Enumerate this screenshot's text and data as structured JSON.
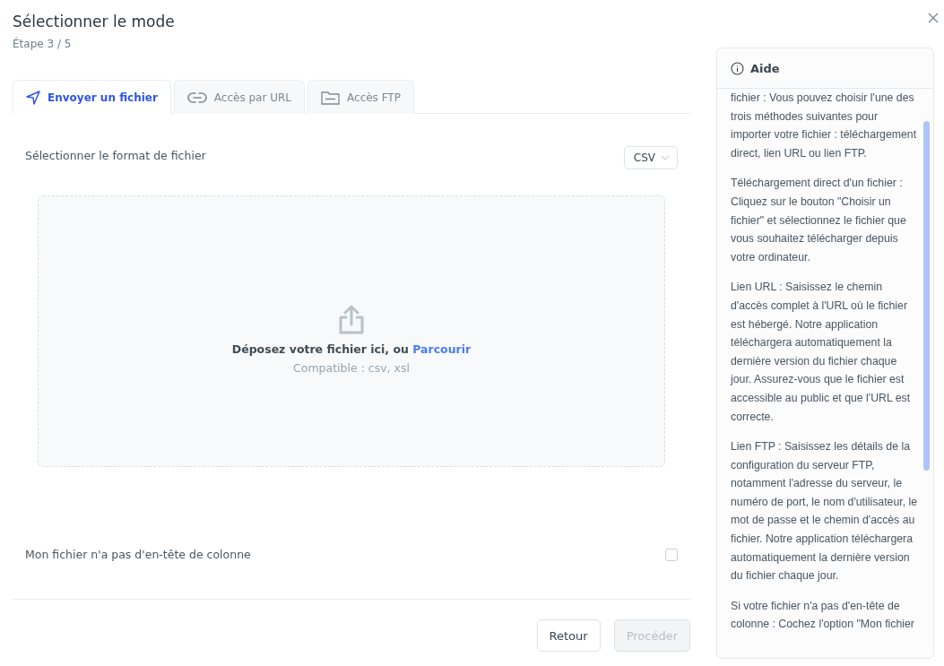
{
  "dialog": {
    "title": "Sélectionner le mode",
    "step": "Étape 3 / 5"
  },
  "tabs": [
    {
      "kind": "send",
      "label": "Envoyer un fichier",
      "selected": true
    },
    {
      "kind": "link",
      "label": "Accès par URL",
      "selected": false
    },
    {
      "kind": "ftp",
      "label": "Accès FTP",
      "selected": false
    }
  ],
  "format": {
    "label": "Sélectionner le format de fichier",
    "value": "CSV"
  },
  "dropzone": {
    "text": "Déposez votre fichier ici, ou",
    "link": "Parcourir",
    "hint": "Compatible : csv, xsl"
  },
  "no_header": {
    "label": "Mon fichier n'a pas d'en-tête de colonne",
    "checked": false
  },
  "buttons": [
    {
      "label": "Retour",
      "disabled": false
    },
    {
      "label": "Procéder",
      "disabled": true
    }
  ],
  "help": {
    "title": "Aide",
    "paragraphs": [
      "fichier : Vous pouvez choisir l'une des trois méthodes suivantes pour importer votre fichier : téléchargement direct, lien URL ou lien FTP.",
      "Téléchargement direct d'un fichier : Cliquez sur le bouton \"Choisir un fichier\" et sélectionnez le fichier que vous souhaitez télécharger depuis votre ordinateur.",
      "Lien URL : Saisissez le chemin d'accès complet à l'URL où le fichier est hébergé. Notre application téléchargera automatiquement la dernière version du fichier chaque jour. Assurez-vous que le fichier est accessible au public et que l'URL est correcte.",
      "Lien FTP : Saisissez les détails de la configuration du serveur FTP, notamment l'adresse du serveur, le numéro de port, le nom d'utilisateur, le mot de passe et le chemin d'accès au fichier. Notre application téléchargera automatiquement la dernière version du fichier chaque jour.",
      "Si votre fichier n'a pas d'en-tête de colonne : Cochez l'option \"Mon fichier"
    ]
  }
}
